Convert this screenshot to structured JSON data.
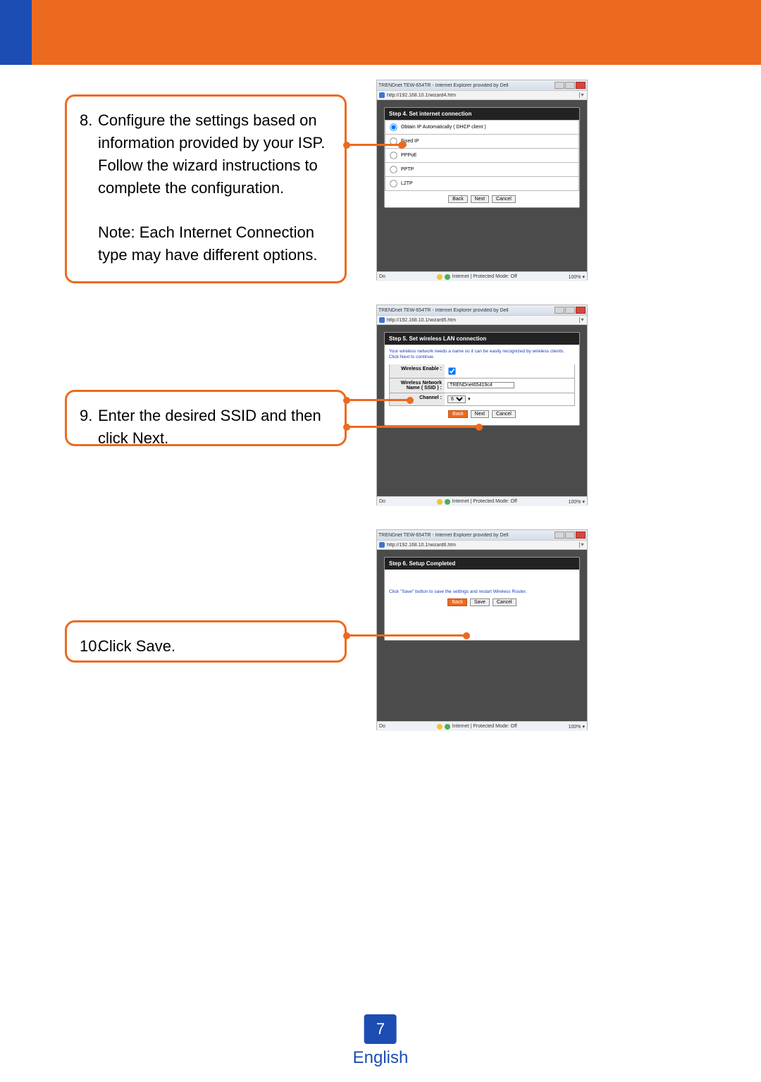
{
  "page": {
    "number": "7",
    "language": "English"
  },
  "callouts": {
    "c8": {
      "num": "8.",
      "text": "Configure the settings based on information provided by your ISP. Follow the wizard instructions to complete the configuration.",
      "note": "Note: Each Internet Connection type may have different options."
    },
    "c9": {
      "num": "9.",
      "text_a": "Enter the desired ",
      "text_b": "SSID",
      "text_c": " and then click ",
      "text_d": "Next",
      "text_e": "."
    },
    "c10": {
      "num": "10.",
      "text_a": "Click ",
      "text_b": "Save",
      "text_c": "."
    }
  },
  "win_common": {
    "title": "TRENDnet TEW-654TR - Internet Explorer provided by Dell",
    "status_left": "Do",
    "status_mid": "Internet | Protected Mode: Off",
    "zoom": "100%"
  },
  "win1": {
    "url": "http://192.168.10.1/wizard4.htm",
    "heading": "Step 4. Set internet connection",
    "options": [
      "Obtain IP Automatically ( DHCP client )",
      "Fixed IP",
      "PPPoE",
      "PPTP",
      "L2TP"
    ],
    "btn_back": "Back",
    "btn_next": "Next",
    "btn_cancel": "Cancel"
  },
  "win2": {
    "url": "http://192.168.10.1/wizard5.htm",
    "heading": "Step 5. Set wireless LAN connection",
    "desc": "Your wireless network needs a name so it can be easily recognized by wireless clients. Click Next to continue.",
    "row1_label": "Wireless Enable :",
    "row2_label": "Wireless Network Name ( SSID ) :",
    "row2_value": "TRENDnet65419c4",
    "row3_label": "Channel :",
    "row3_value": "6",
    "btn_back": "Back",
    "btn_next": "Next",
    "btn_cancel": "Cancel"
  },
  "win3": {
    "url": "http://192.168.10.1/wizard6.htm",
    "heading": "Step 6. Setup Completed",
    "desc": "Click \"Save\" button to save the settings and restart Wireless Router.",
    "btn_back": "Back",
    "btn_save": "Save",
    "btn_cancel": "Cancel"
  }
}
